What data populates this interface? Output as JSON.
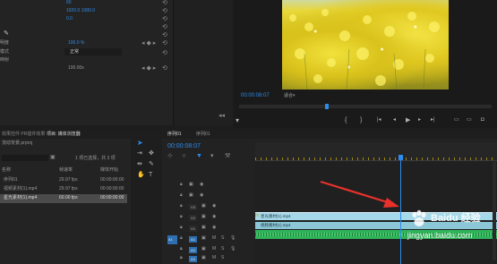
{
  "effect_controls": {
    "rows": [
      {
        "label": "",
        "value": "60"
      },
      {
        "label": "",
        "value": "1920.0   1080.0"
      },
      {
        "label": "",
        "value": "0.0"
      },
      {
        "label": "",
        "value": ""
      },
      {
        "label": "",
        "value": ""
      },
      {
        "label": "明度",
        "value": "100.0 %"
      },
      {
        "label": "模式",
        "value": "正常"
      },
      {
        "label": "映射",
        "value": ""
      },
      {
        "label": "",
        "value": "100.00s"
      }
    ]
  },
  "program_monitor": {
    "timecode": "00:00:08:07",
    "fit": "适合"
  },
  "project_panel": {
    "tab1": "效果控件 PR插件效果",
    "tab2": "项目: 媒体浏览器",
    "filename": "流动背景.prproj",
    "selection_info": "1 项已选择，共 3 项",
    "columns": [
      "名称",
      "帧速率",
      "媒体开始"
    ],
    "items": [
      {
        "name": "序列01",
        "fps": "29.97 fps",
        "start": "00:00:00:00"
      },
      {
        "name": "视频素材(1).mp4",
        "fps": "29.97 fps",
        "start": "00:00:00:00"
      },
      {
        "name": "星光素材(1).mp4",
        "fps": "60.00 fps",
        "start": "00:00:00:00"
      }
    ]
  },
  "timeline": {
    "tab_a": "序列01",
    "tab_b": "序列01",
    "timecode": "00:00:08:07",
    "tracks": [
      "V3",
      "V2",
      "V1",
      "A1",
      "A2",
      "A3"
    ],
    "clip_v2": "星光素材(1).mp4",
    "clip_v1": "视频素材(1).mp4",
    "source_patch": "A1"
  },
  "watermark": {
    "brand": "Baidu 经验",
    "url": "jingyan.baidu.com"
  },
  "colors": {
    "accent_blue": "#2d8ceb",
    "clip_video": "#a5d8e8",
    "clip_audio": "#2fb35a",
    "arrow": "#e8312a"
  }
}
